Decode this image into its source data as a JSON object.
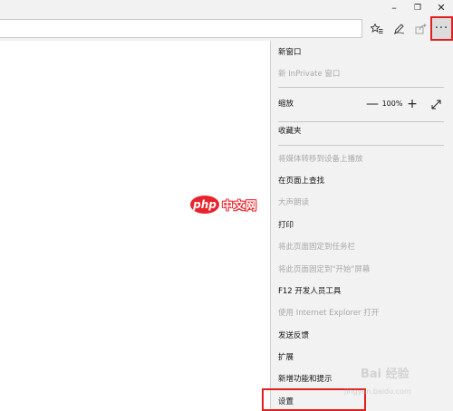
{
  "window": {
    "min_glyph": "–",
    "max_glyph": "❐",
    "close_glyph": "✕"
  },
  "toolbar": {
    "more_glyph": "···"
  },
  "menu": {
    "items": [
      {
        "label": "新窗口",
        "enabled": true
      },
      {
        "label": "新 InPrivate 窗口",
        "enabled": false
      },
      {
        "label": "缩放",
        "enabled": true
      },
      {
        "label": "收藏夹",
        "enabled": true
      },
      {
        "label": "将媒体转移到设备上播放",
        "enabled": false
      },
      {
        "label": "在页面上查找",
        "enabled": true
      },
      {
        "label": "大声朗读",
        "enabled": false
      },
      {
        "label": "打印",
        "enabled": true
      },
      {
        "label": "将此页面固定到任务栏",
        "enabled": false
      },
      {
        "label": "将此页面固定到\"开始\"屏幕",
        "enabled": false
      },
      {
        "label": "F12 开发人员工具",
        "enabled": true
      },
      {
        "label": "使用 Internet Explorer 打开",
        "enabled": false
      },
      {
        "label": "发送反馈",
        "enabled": true
      },
      {
        "label": "扩展",
        "enabled": true
      },
      {
        "label": "新增功能和提示",
        "enabled": true
      },
      {
        "label": "设置",
        "enabled": true
      }
    ],
    "zoom": {
      "minus": "—",
      "value": "100%",
      "plus": "+"
    }
  },
  "watermark": {
    "logo": "php",
    "text": "中文网"
  },
  "baidu": {
    "text": "Bai 经验",
    "url": "jingyan.baidu.com"
  },
  "colors": {
    "highlight": "#e02020",
    "menu_bg": "#f2f2f2",
    "disabled_text": "#a8a8a8"
  }
}
